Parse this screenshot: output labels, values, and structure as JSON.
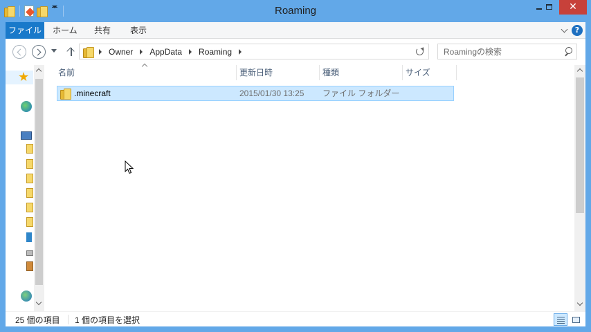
{
  "window": {
    "title": "Roaming",
    "close_glyph": "✕"
  },
  "ribbon": {
    "tabs": [
      {
        "label": "ファイル"
      },
      {
        "label": "ホーム"
      },
      {
        "label": "共有"
      },
      {
        "label": "表示"
      }
    ],
    "help_glyph": "?"
  },
  "address": {
    "path": [
      "Owner",
      "AppData",
      "Roaming"
    ]
  },
  "search": {
    "placeholder": "Roamingの検索"
  },
  "columns": {
    "name": "名前",
    "date": "更新日時",
    "type": "種類",
    "size": "サイズ"
  },
  "files": [
    {
      "name": ".minecraft",
      "date": "2015/01/30 13:25",
      "type": "ファイル フォルダー",
      "size": ""
    }
  ],
  "status": {
    "count": "25 個の項目",
    "selected": "1 個の項目を選択"
  },
  "colors": {
    "titlebar": "#62a8e8",
    "file_tab": "#1979ca",
    "selection": "#cce8ff",
    "close_button": "#c7413a"
  }
}
